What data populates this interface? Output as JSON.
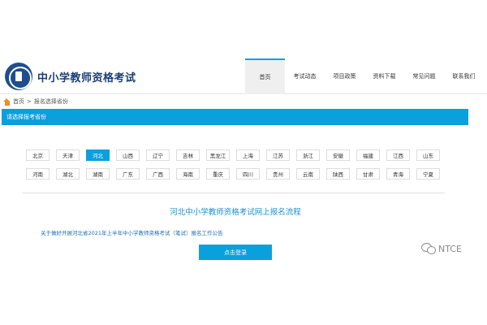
{
  "header": {
    "site_title": "中小学教师资格考试",
    "logo_icon": "exam-emblem-icon",
    "nav": [
      {
        "label": "首页",
        "active": true
      },
      {
        "label": "考试动态",
        "active": false
      },
      {
        "label": "项目政策",
        "active": false
      },
      {
        "label": "资料下载",
        "active": false
      },
      {
        "label": "常见问题",
        "active": false
      },
      {
        "label": "联系我们",
        "active": false
      }
    ]
  },
  "breadcrumb": {
    "icon": "home-icon",
    "home": "首页",
    "separator": ">",
    "current": "报名选择省份"
  },
  "section": {
    "title": "请选择报考省份"
  },
  "provinces": [
    {
      "name": "北京",
      "selected": false
    },
    {
      "name": "天津",
      "selected": false
    },
    {
      "name": "河北",
      "selected": true
    },
    {
      "name": "山西",
      "selected": false
    },
    {
      "name": "辽宁",
      "selected": false
    },
    {
      "name": "吉林",
      "selected": false
    },
    {
      "name": "黑龙江",
      "selected": false
    },
    {
      "name": "上海",
      "selected": false
    },
    {
      "name": "江苏",
      "selected": false
    },
    {
      "name": "浙江",
      "selected": false
    },
    {
      "name": "安徽",
      "selected": false
    },
    {
      "name": "福建",
      "selected": false
    },
    {
      "name": "江西",
      "selected": false
    },
    {
      "name": "山东",
      "selected": false
    },
    {
      "name": "河南",
      "selected": false
    },
    {
      "name": "湖北",
      "selected": false
    },
    {
      "name": "湖南",
      "selected": false
    },
    {
      "name": "广东",
      "selected": false
    },
    {
      "name": "广西",
      "selected": false
    },
    {
      "name": "海南",
      "selected": false
    },
    {
      "name": "重庆",
      "selected": false
    },
    {
      "name": "四川",
      "selected": false
    },
    {
      "name": "贵州",
      "selected": false
    },
    {
      "name": "云南",
      "selected": false
    },
    {
      "name": "陕西",
      "selected": false
    },
    {
      "name": "甘肃",
      "selected": false
    },
    {
      "name": "青海",
      "selected": false
    },
    {
      "name": "宁夏",
      "selected": false
    }
  ],
  "process": {
    "title": "河北中小学教师资格考试网上报名流程",
    "notice_link": "关于做好开展河北省2021年上半年中小学教师资格考试（笔试）报名工作公告",
    "login_button": "点击登录"
  },
  "watermark": {
    "icon": "wechat-icon",
    "text": "NTCE"
  },
  "colors": {
    "accent": "#0aa0dc",
    "brand": "#1a3f73",
    "link": "#1d6fb8",
    "home_icon": "#f08c2a"
  }
}
